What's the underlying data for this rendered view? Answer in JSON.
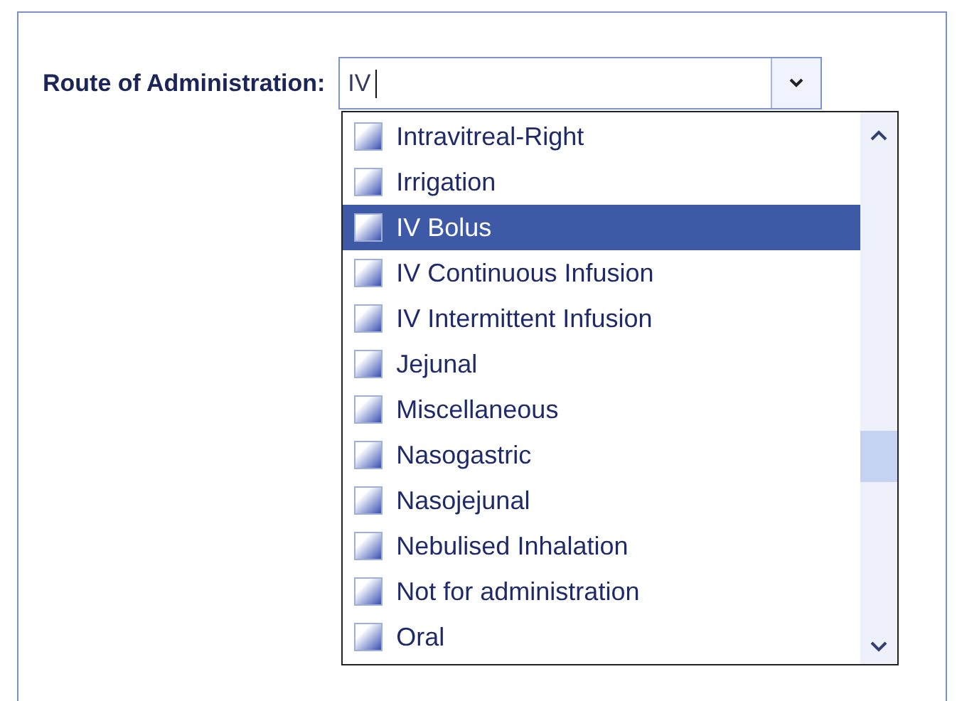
{
  "field": {
    "label": "Route of Administration:",
    "value": "IV"
  },
  "options": [
    {
      "label": "Intravitreal-Right",
      "selected": false
    },
    {
      "label": "Irrigation",
      "selected": false
    },
    {
      "label": "IV Bolus",
      "selected": true
    },
    {
      "label": "IV Continuous Infusion",
      "selected": false
    },
    {
      "label": "IV Intermittent Infusion",
      "selected": false
    },
    {
      "label": "Jejunal",
      "selected": false
    },
    {
      "label": "Miscellaneous",
      "selected": false
    },
    {
      "label": "Nasogastric",
      "selected": false
    },
    {
      "label": "Nasojejunal",
      "selected": false
    },
    {
      "label": "Nebulised Inhalation",
      "selected": false
    },
    {
      "label": "Not for administration",
      "selected": false
    },
    {
      "label": "Oral",
      "selected": false
    }
  ]
}
